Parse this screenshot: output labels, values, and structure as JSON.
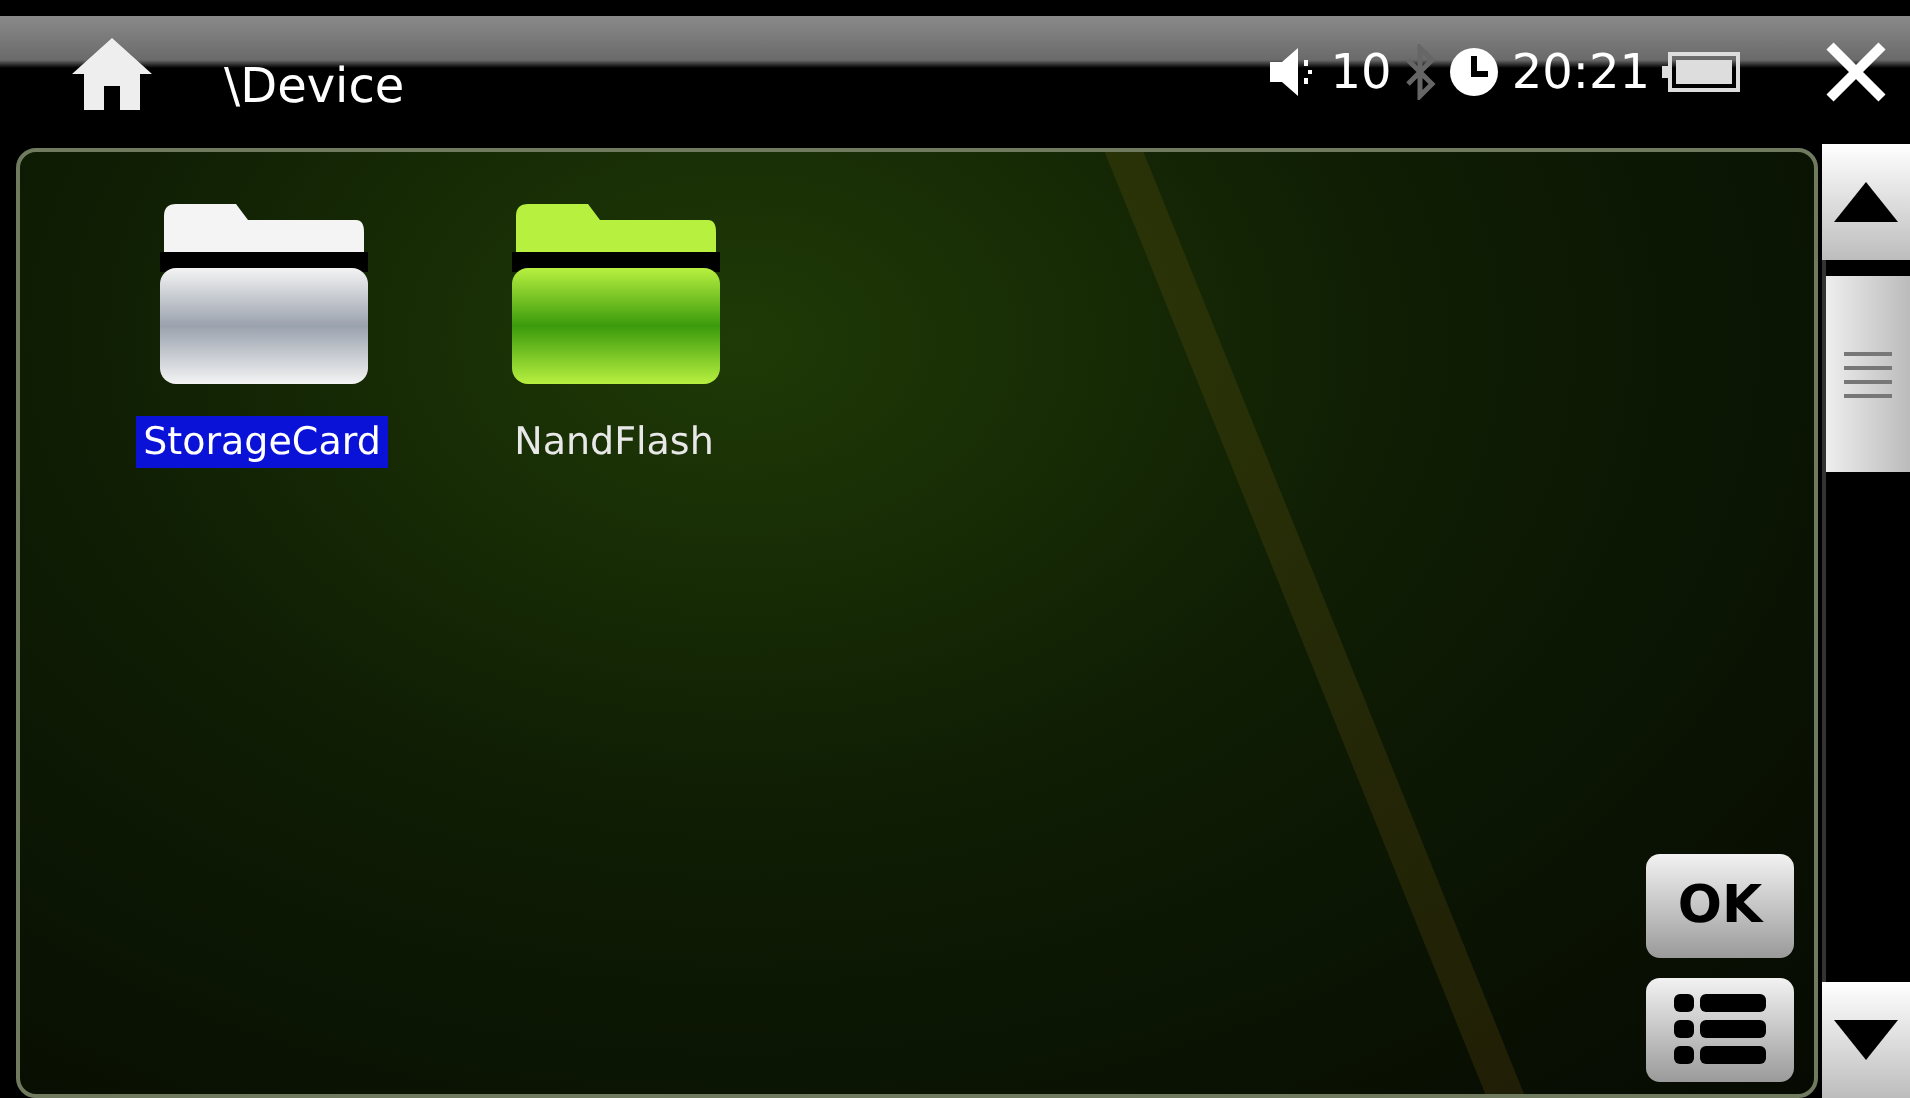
{
  "title_bar": {
    "path": "\\Device",
    "volume": "10",
    "time": "20:21"
  },
  "folders": [
    {
      "name": "StorageCard",
      "kind": "silver",
      "selected": true
    },
    {
      "name": "NandFlash",
      "kind": "green",
      "selected": false
    }
  ],
  "buttons": [
    {
      "kind": "text",
      "label": "OK"
    },
    {
      "kind": "list"
    }
  ]
}
